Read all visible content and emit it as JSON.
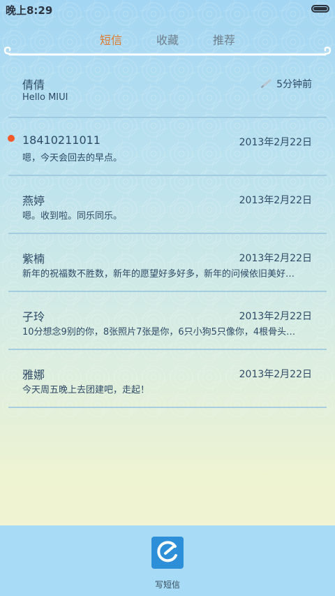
{
  "status_bar": {
    "time": "晚上8:29",
    "battery_level": 1.0
  },
  "tabs": [
    {
      "label": "短信",
      "active": true
    },
    {
      "label": "收藏",
      "active": false
    },
    {
      "label": "推荐",
      "active": false
    }
  ],
  "conversations": [
    {
      "name": "倩倩",
      "time": "5分钟前",
      "snippet": "Hello MIUI",
      "draft": true,
      "unread": false
    },
    {
      "name": "18410211011",
      "time": "2013年2月22日",
      "snippet": "嗯，今天会回去的早点。",
      "draft": false,
      "unread": false
    },
    {
      "name": "燕婷",
      "time": "2013年2月22日",
      "snippet": "嗯。收到啦。同乐同乐。",
      "draft": false,
      "unread": true
    },
    {
      "name": "紫楠",
      "time": "2013年2月22日",
      "snippet": "新年的祝福数不胜数，新年的愿望好多好多，新年的问候依旧美好…",
      "draft": false,
      "unread": false
    },
    {
      "name": "子玲",
      "time": "2013年2月22日",
      "snippet": "10分想念9别的你，8张照片7张是你，6只小狗5只像你，4根骨头…",
      "draft": false,
      "unread": false
    },
    {
      "name": "雅娜",
      "time": "2013年2月22日",
      "snippet": "今天周五晚上去团建吧，走起！",
      "draft": false,
      "unread": false
    }
  ],
  "compose": {
    "label": "写短信"
  },
  "colors": {
    "accent": "#e0782c",
    "text": "#2e4a66",
    "unread_dot": "#f0592a",
    "compose_button": "#2d8fd8",
    "bottom_bar": "#a8dcf6"
  }
}
